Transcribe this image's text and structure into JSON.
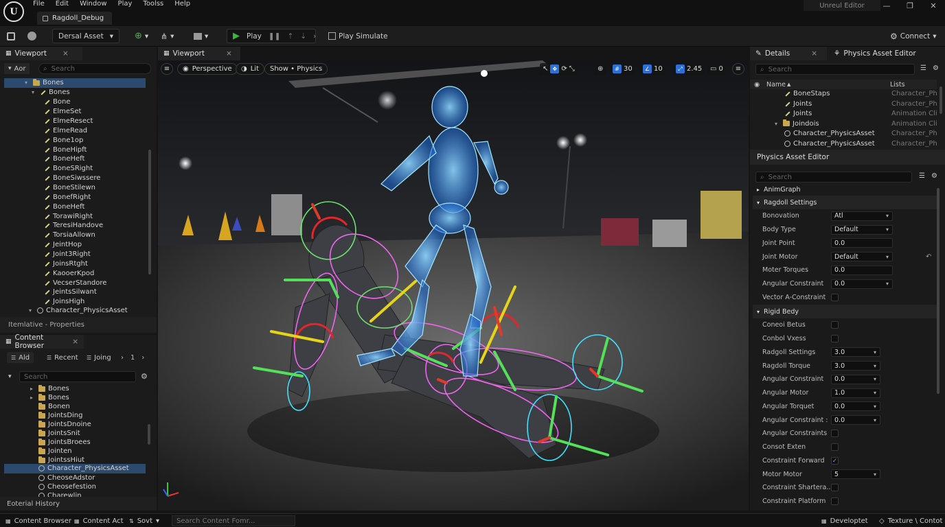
{
  "app": {
    "logo": "U",
    "menu": [
      "File",
      "Edit",
      "Window",
      "Play",
      "Toolss",
      "Help"
    ],
    "doc_tab": "Ragdoll_Debug",
    "app_name": "Unreul Editor",
    "win_buttons": [
      "—",
      "❐",
      "✕"
    ]
  },
  "toolbar": {
    "asset_dropdown": "Dersal Asset",
    "play_label": "Play",
    "play_simulate": "Play Simulate",
    "connect": "Connect"
  },
  "skeleton_panel": {
    "tab": "Viewport",
    "filter_label": "Aor",
    "search_placeholder": "Search",
    "root": "Bones",
    "group": "Bones",
    "bones": [
      "Bone",
      "ElmeSet",
      "ElmeResect",
      "ElmeRead",
      "Bone1op",
      "BoneHipft",
      "BoneHeft",
      "BoneSRight",
      "BoneSiwssere",
      "BoneStilewn",
      "BonefRight",
      "BoneHeft",
      "TorawiRight",
      "TeresiHandove",
      "TorsiaAllown",
      "JeintHop",
      "Joint3Right",
      "JoinsRtght",
      "KaooerKpod",
      "VecserStandore",
      "JeintsSilwant",
      "JoinsHigh"
    ],
    "asset": "Character_PhysicsAsset",
    "footer": "Itemlative - Properties"
  },
  "content_browser": {
    "tab": "Content Browser",
    "buttons": [
      "Ald",
      "Recent",
      "Joing"
    ],
    "page": "1",
    "search_placeholder": "Search",
    "folders": [
      "Bones",
      "Bones",
      "Bonen",
      "JointsDing",
      "JointsDnoine",
      "JointsSnit",
      "JointsBroees",
      "Jointen",
      "JointssHiut"
    ],
    "selected_asset": "Character_PhysicsAsset",
    "items": [
      "CheoseAdstor",
      "Cheosefestion",
      "Charewlin"
    ],
    "footer": "Eoterial History"
  },
  "viewport": {
    "tab": "Viewport",
    "perspective": "Perspective",
    "lit": "Lit",
    "show": "Show • Physics",
    "grid": "30",
    "angle": "10",
    "scale": "2.45",
    "cam": "0"
  },
  "details": {
    "tab_details": "Details",
    "tab_editor": "Physics Asset Editor",
    "search_placeholder": "Search",
    "col_name": "Name",
    "col_lists": "Lists",
    "rows": [
      {
        "name": "BoneStaps",
        "type": "Character_Phy",
        "indent": 3,
        "icon": "bone"
      },
      {
        "name": "Joints",
        "type": "Character_Phy",
        "indent": 3,
        "icon": "bone"
      },
      {
        "name": "Joints",
        "type": "Animation Clip",
        "indent": 3,
        "icon": "bone"
      },
      {
        "name": "Joindois",
        "type": "Animation Clip",
        "indent": 2,
        "icon": "folder"
      },
      {
        "name": "Character_PhysicsAsset",
        "type": "Character_Phy",
        "indent": 3,
        "icon": "asset"
      },
      {
        "name": "Character_PhysicsAsset",
        "type": "Character_Phy",
        "indent": 3,
        "icon": "asset"
      }
    ]
  },
  "physics_editor": {
    "title": "Physics Asset Editor",
    "search_placeholder": "Search",
    "section_animgraph": "AnimGraph",
    "section_ragdoll": "Ragdoll Settings",
    "ragdoll_props": [
      {
        "label": "Bonovation",
        "value": "Atl",
        "kind": "dropdown"
      },
      {
        "label": "Body Type",
        "value": "Default",
        "kind": "dropdown"
      },
      {
        "label": "Joint Point",
        "value": "0.0",
        "kind": "text"
      },
      {
        "label": "Joint Motor",
        "value": "Default",
        "kind": "dropdown"
      },
      {
        "label": "Moter Torques",
        "value": "0.0",
        "kind": "text"
      },
      {
        "label": "Angular Constraint",
        "value": "0.0",
        "kind": "dropdown"
      },
      {
        "label": "Vector A-Constraint",
        "value": "",
        "kind": "check"
      }
    ],
    "section_rigid": "Rigid Bedy",
    "rigid_props": [
      {
        "label": "Coneoi Betus",
        "value": "",
        "kind": "check"
      },
      {
        "label": "Conbol Vxess",
        "value": "",
        "kind": "check"
      },
      {
        "label": "Radgoll Settings",
        "value": "3.0",
        "kind": "dropdown"
      },
      {
        "label": "Ragdoll Torque",
        "value": "3.0",
        "kind": "dropdown"
      },
      {
        "label": "Angular Constraint",
        "value": "0.0",
        "kind": "dropdown"
      },
      {
        "label": "Angular Motor",
        "value": "1.0",
        "kind": "dropdown"
      },
      {
        "label": "Angular Torquet",
        "value": "0.0",
        "kind": "dropdown"
      },
      {
        "label": "Angular Constraint :",
        "value": "0.0",
        "kind": "dropdown"
      },
      {
        "label": "Angular Constraints",
        "value": "",
        "kind": "check"
      },
      {
        "label": "Consot Exten",
        "value": "",
        "kind": "check"
      },
      {
        "label": "Constraint Forward",
        "value": "✓",
        "kind": "check"
      },
      {
        "label": "Motor Motor",
        "value": "5",
        "kind": "dropdown"
      },
      {
        "label": "Constraint Shartera...",
        "value": "",
        "kind": "check"
      },
      {
        "label": "Constraint Platform",
        "value": "",
        "kind": "check"
      }
    ]
  },
  "statusbar": {
    "content_browser": "Content Browser",
    "content_act": "Content Act",
    "sort": "Sovt",
    "search_placeholder": "Search Content Fomr...",
    "developer": "Developtet",
    "texture": "Texture \\ Contot"
  }
}
